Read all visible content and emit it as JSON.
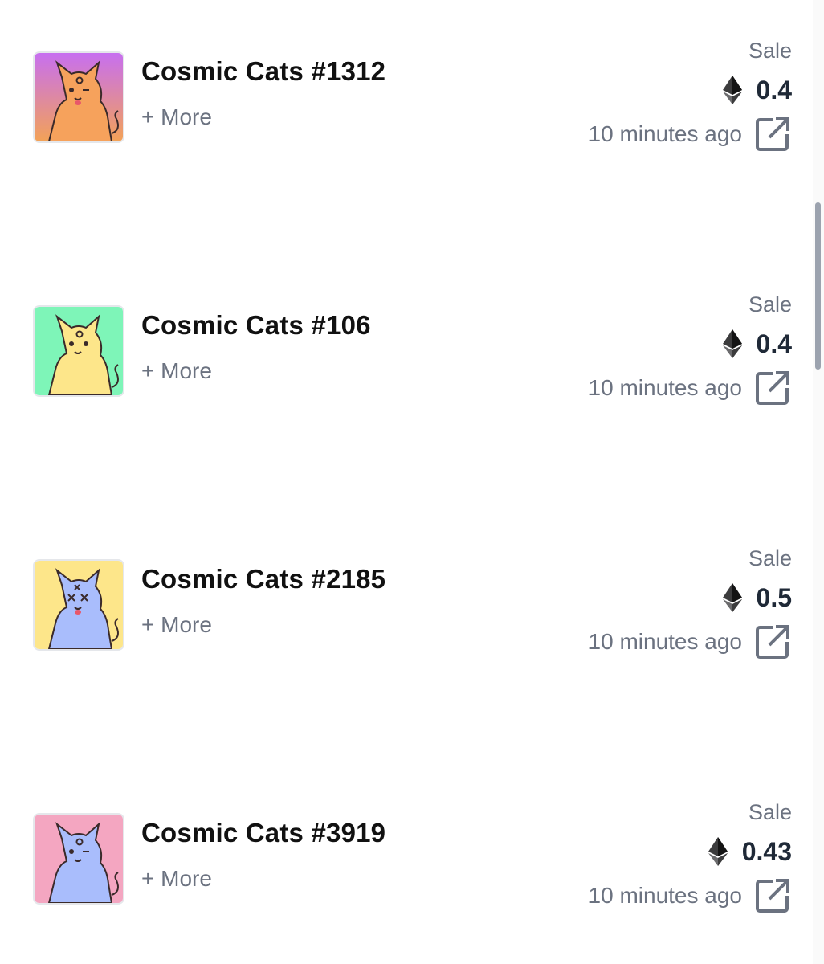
{
  "feed": {
    "items": [
      {
        "name": "Cosmic Cats #1312",
        "more": "+ More",
        "event": "Sale",
        "price": "0.4",
        "time": "10 minutes ago",
        "bg_top": "#c76ff0",
        "bg_bottom": "#d28bd8",
        "cat_color": "#f6a25c",
        "icon": "ether-icon"
      },
      {
        "name": "Cosmic Cats #106",
        "more": "+ More",
        "event": "Sale",
        "price": "0.4",
        "time": "10 minutes ago",
        "bg_top": "#7ef5b8",
        "bg_bottom": "#7ef5b8",
        "cat_color": "#fde68a",
        "icon": "ether-icon"
      },
      {
        "name": "Cosmic Cats #2185",
        "more": "+ More",
        "event": "Sale",
        "price": "0.5",
        "time": "10 minutes ago",
        "bg_top": "#fde68a",
        "bg_bottom": "#fde68a",
        "cat_color": "#a9bdfc",
        "icon": "ether-icon"
      },
      {
        "name": "Cosmic Cats #3919",
        "more": "+ More",
        "event": "Sale",
        "price": "0.43",
        "time": "10 minutes ago",
        "bg_top": "#f4a6c1",
        "bg_bottom": "#f4a6c1",
        "cat_color": "#a9bdfc",
        "icon": "ether-icon"
      }
    ]
  },
  "colors": {
    "text_primary": "#111111",
    "text_secondary": "#6b7280",
    "ether": "#3c3c3d"
  }
}
